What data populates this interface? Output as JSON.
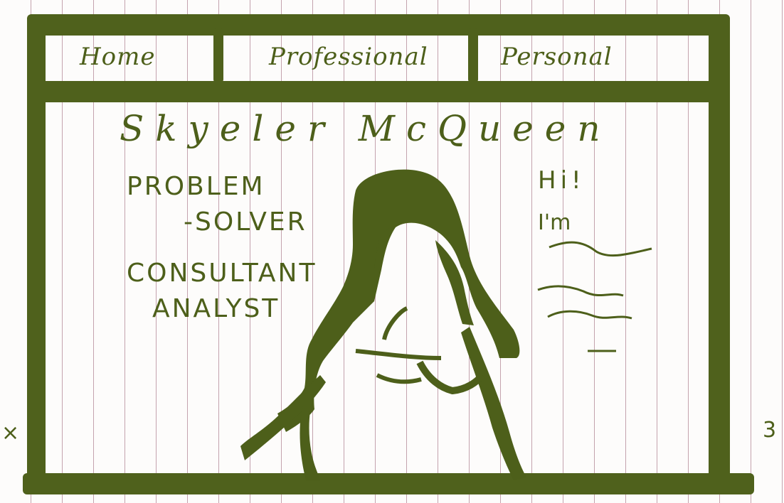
{
  "nav": {
    "tabs": [
      {
        "label": "Home"
      },
      {
        "label": "Professional"
      },
      {
        "label": "Personal"
      }
    ]
  },
  "header": {
    "name": "Skyeler McQueen"
  },
  "roles": [
    "PROBLEM",
    "-SOLVER",
    "CONSULTANT",
    "ANALYST"
  ],
  "intro": {
    "greeting": "Hi!",
    "line": "I'm"
  },
  "colors": {
    "ink": "#4f611c",
    "paper": "#fdfcfb",
    "ruling": "#965a6e"
  }
}
